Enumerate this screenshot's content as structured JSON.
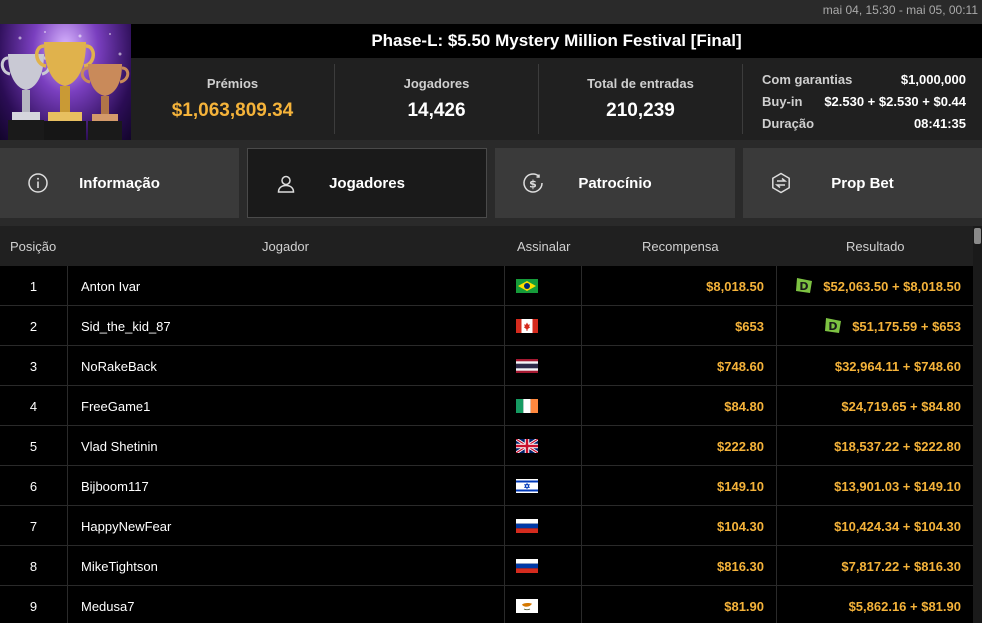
{
  "date_range": "mai 04, 15:30 - mai 05, 00:11",
  "tournament": {
    "title": "Phase-L: $5.50 Mystery Million Festival [Final]",
    "prizes_label": "Prémios",
    "prizes_value": "$1,063,809.34",
    "players_label": "Jogadores",
    "players_value": "14,426",
    "entries_label": "Total de entradas",
    "entries_value": "210,239",
    "guarantee_label": "Com garantias",
    "guarantee_value": "$1,000,000",
    "buyin_label": "Buy-in",
    "buyin_value": "$2.530 + $2.530 + $0.44",
    "duration_label": "Duração",
    "duration_value": "08:41:35"
  },
  "tabs": [
    {
      "label": "Informação",
      "icon": "info-icon",
      "active": false
    },
    {
      "label": "Jogadores",
      "icon": "user-icon",
      "active": true
    },
    {
      "label": "Patrocínio",
      "icon": "dollar-circle-icon",
      "active": false
    },
    {
      "label": "Prop Bet",
      "icon": "prop-bet-icon",
      "active": false
    }
  ],
  "table": {
    "headers": {
      "position": "Posição",
      "player": "Jogador",
      "flag": "Assinalar",
      "reward": "Recompensa",
      "result": "Resultado"
    },
    "rows": [
      {
        "pos": "1",
        "name": "Anton Ivar",
        "flag": "brazil",
        "reward": "$8,018.50",
        "result": "$52,063.50 + $8,018.50",
        "badge": "D"
      },
      {
        "pos": "2",
        "name": "Sid_the_kid_87",
        "flag": "canada",
        "reward": "$653",
        "result": "$51,175.59 + $653",
        "badge": "D"
      },
      {
        "pos": "3",
        "name": "NoRakeBack",
        "flag": "thailand",
        "reward": "$748.60",
        "result": "$32,964.11 + $748.60",
        "badge": ""
      },
      {
        "pos": "4",
        "name": "FreeGame1",
        "flag": "ireland",
        "reward": "$84.80",
        "result": "$24,719.65 + $84.80",
        "badge": ""
      },
      {
        "pos": "5",
        "name": "Vlad Shetinin",
        "flag": "united-kingdom",
        "reward": "$222.80",
        "result": "$18,537.22 + $222.80",
        "badge": ""
      },
      {
        "pos": "6",
        "name": "Bijboom117",
        "flag": "israel",
        "reward": "$149.10",
        "result": "$13,901.03 + $149.10",
        "badge": ""
      },
      {
        "pos": "7",
        "name": "HappyNewFear",
        "flag": "russia",
        "reward": "$104.30",
        "result": "$10,424.34 + $104.30",
        "badge": ""
      },
      {
        "pos": "8",
        "name": "MikeTightson",
        "flag": "russia",
        "reward": "$816.30",
        "result": "$7,817.22 + $816.30",
        "badge": ""
      },
      {
        "pos": "9",
        "name": "Medusa7",
        "flag": "cyprus",
        "reward": "$81.90",
        "result": "$5,862.16 + $81.90",
        "badge": ""
      }
    ]
  },
  "colors": {
    "accent_gold": "#f5b33a",
    "badge_green": "#7dc242"
  }
}
